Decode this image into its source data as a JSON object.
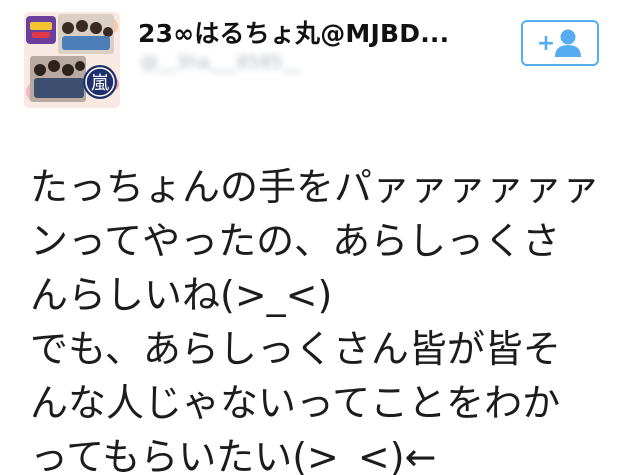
{
  "profile": {
    "display_name": "23∞はるちょ丸@MJBD...",
    "screen_name": "@__3ha___8585__",
    "avatar_icon": "avatar-image",
    "avatar_text": "嵐"
  },
  "follow_button": {
    "icon": "follow-user-icon",
    "plus_glyph": "+",
    "color": "#55acee"
  },
  "tweet": {
    "lines": [
      "たっちょんの手をパァァァァァァ",
      "ンってやったの、あらしっくさ",
      "んらしいね(>_<)",
      "でも、あらしっくさん皆が皆そ",
      "んな人じゃないってことをわか",
      "ってもらいたい(>_<)←"
    ]
  }
}
